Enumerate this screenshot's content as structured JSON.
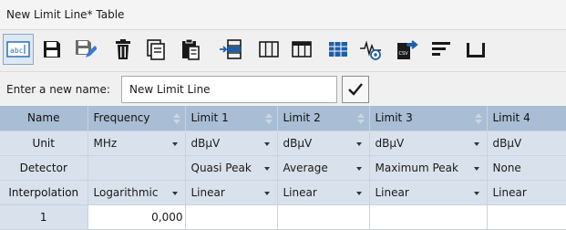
{
  "window": {
    "title": "New Limit Line* Table"
  },
  "toolbar": {
    "buttons": [
      {
        "name": "rename-button",
        "icon": "abc-text-icon"
      },
      {
        "name": "save-button",
        "icon": "save-icon"
      },
      {
        "name": "save-as-button",
        "icon": "save-as-icon"
      },
      {
        "name": "delete-button",
        "icon": "trash-icon"
      },
      {
        "name": "copy-button",
        "icon": "copy-icon"
      },
      {
        "name": "paste-button",
        "icon": "paste-icon"
      },
      {
        "name": "insert-row-button",
        "icon": "insert-row-icon"
      },
      {
        "name": "columns-button",
        "icon": "columns-icon"
      },
      {
        "name": "header-columns-button",
        "icon": "header-columns-icon"
      },
      {
        "name": "table-view-button",
        "icon": "table-grid-icon"
      },
      {
        "name": "signal-view-button",
        "icon": "signal-trace-icon"
      },
      {
        "name": "export-csv-button",
        "icon": "export-csv-icon"
      },
      {
        "name": "format-button",
        "icon": "lines-icon"
      },
      {
        "name": "print-button",
        "icon": "tray-icon"
      }
    ]
  },
  "name_row": {
    "label": "Enter a new name:",
    "value": "New Limit Line",
    "ok_icon": "checkmark-icon"
  },
  "table": {
    "corner_label": "Name",
    "columns": [
      "Frequency",
      "Limit 1",
      "Limit 2",
      "Limit 3",
      "Limit 4"
    ],
    "unit_row": {
      "label": "Unit",
      "values": [
        "MHz",
        "dBμV",
        "dBμV",
        "dBμV",
        "dBμV"
      ]
    },
    "detector_row": {
      "label": "Detector",
      "values": [
        "",
        "Quasi Peak",
        "Average",
        "Maximum Peak",
        "None"
      ]
    },
    "interpolation_row": {
      "label": "Interpolation",
      "values": [
        "Logarithmic",
        "Linear",
        "Linear",
        "Linear",
        "Linear"
      ]
    },
    "data_rows": [
      {
        "index": "1",
        "values": [
          "0,000",
          "",
          "",
          "",
          ""
        ]
      }
    ]
  },
  "colors": {
    "header_bg": "#a9bdd4",
    "settings_bg": "#d9e2ec",
    "accent": "#1f5fa8"
  }
}
